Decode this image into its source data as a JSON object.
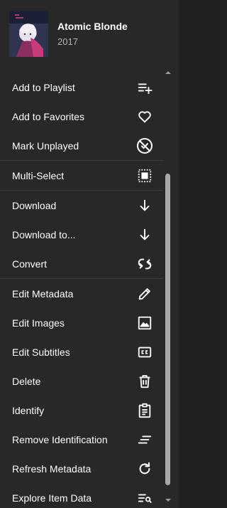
{
  "item": {
    "title": "Atomic Blonde",
    "year": "2017"
  },
  "menu": {
    "items": [
      {
        "label": "Add to Playlist",
        "icon": "playlist-add-icon"
      },
      {
        "label": "Add to Favorites",
        "icon": "heart-icon"
      },
      {
        "label": "Mark Unplayed",
        "icon": "unplayed-icon"
      },
      {
        "label": "Multi-Select",
        "icon": "select-all-icon"
      },
      {
        "label": "Download",
        "icon": "download-icon"
      },
      {
        "label": "Download to...",
        "icon": "download-to-icon"
      },
      {
        "label": "Convert",
        "icon": "convert-icon"
      },
      {
        "label": "Edit Metadata",
        "icon": "pencil-icon"
      },
      {
        "label": "Edit Images",
        "icon": "image-icon"
      },
      {
        "label": "Edit Subtitles",
        "icon": "closed-captions-icon"
      },
      {
        "label": "Delete",
        "icon": "trash-icon"
      },
      {
        "label": "Identify",
        "icon": "clipboard-icon"
      },
      {
        "label": "Remove Identification",
        "icon": "clear-lines-icon"
      },
      {
        "label": "Refresh Metadata",
        "icon": "refresh-icon"
      },
      {
        "label": "Explore Item Data",
        "icon": "list-search-icon"
      }
    ]
  },
  "colors": {
    "background": "#282828",
    "text": "#ffffff",
    "subtext": "#b3b3b3",
    "separator": "#3c3c3c",
    "scrollbar": "#a8a8a8"
  }
}
